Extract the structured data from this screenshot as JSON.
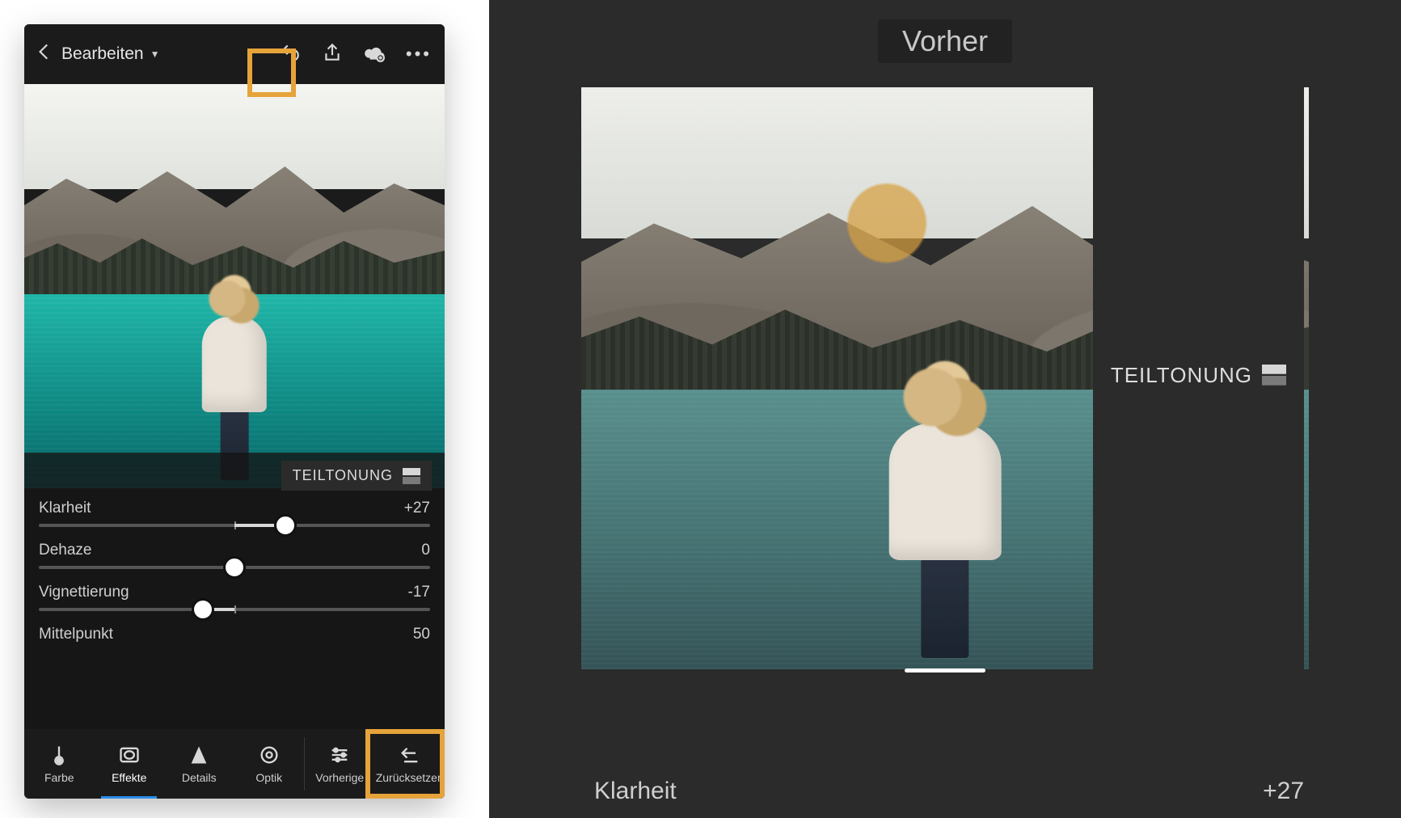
{
  "accent_highlight": "#e6a33a",
  "left": {
    "header": {
      "title": "Bearbeiten",
      "icons": {
        "back": "back-icon",
        "undo": "undo-icon",
        "share": "share-icon",
        "cloud": "cloud-add-icon",
        "more": "more-icon"
      }
    },
    "split_toning_label": "TEILTONUNG",
    "sliders": [
      {
        "name": "Klarheit",
        "value": "+27",
        "percent": 63
      },
      {
        "name": "Dehaze",
        "value": "0",
        "percent": 50
      },
      {
        "name": "Vignettierung",
        "value": "-17",
        "percent": 42
      },
      {
        "name": "Mittelpunkt",
        "value": "50",
        "percent": 50
      }
    ],
    "tools": [
      {
        "label": "Farbe",
        "icon": "thermometer-icon",
        "active": false
      },
      {
        "label": "Effekte",
        "icon": "vignette-icon",
        "active": true
      },
      {
        "label": "Details",
        "icon": "sharpen-icon",
        "active": false
      },
      {
        "label": "Optik",
        "icon": "lens-icon",
        "active": false
      }
    ],
    "right_tools": [
      {
        "label": "Vorherige",
        "icon": "sliders-icon"
      },
      {
        "label": "Zurücksetzen",
        "icon": "reset-icon"
      }
    ]
  },
  "right": {
    "before_label": "Vorher",
    "split_toning_label": "TEILTONUNG",
    "klarheit_label": "Klarheit",
    "klarheit_value": "+27"
  }
}
